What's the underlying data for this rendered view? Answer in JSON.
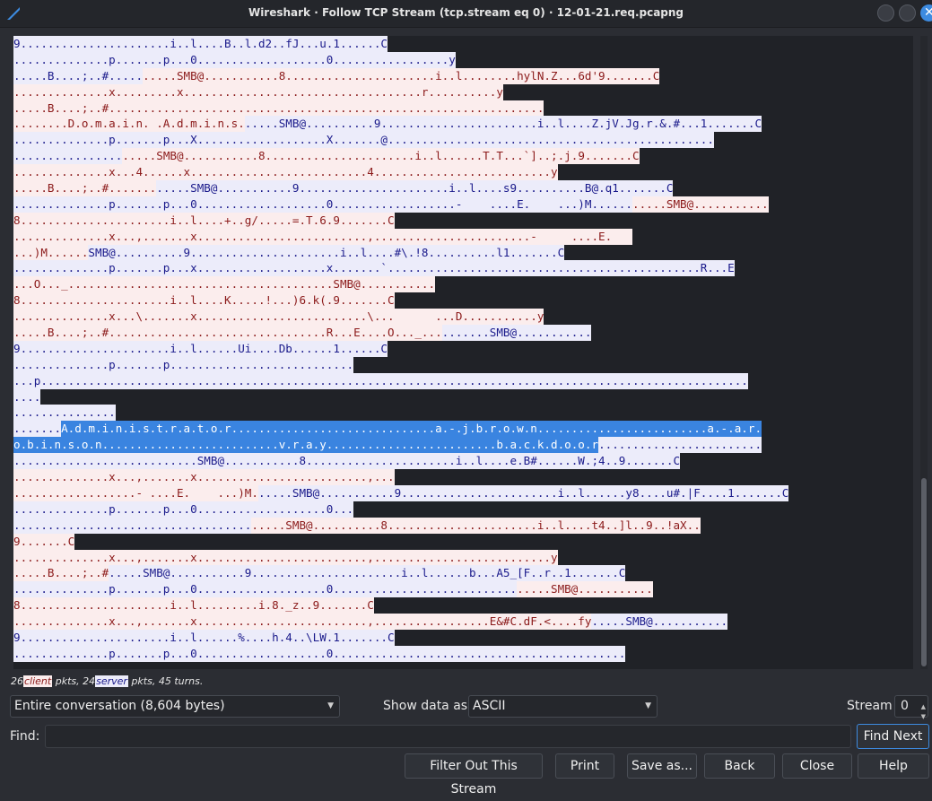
{
  "window": {
    "title": "Wireshark · Follow TCP Stream (tcp.stream eq 0) · 12-01-21.req.pcapng"
  },
  "stream_lines": [
    [
      [
        "s",
        "9......................i..l....B..l.d2..fJ...u.1......C"
      ]
    ],
    [
      [
        "s",
        "..............p.......p...0...................0.................y"
      ]
    ],
    [
      [
        "s",
        ".....B....;..#....."
      ],
      [
        "c",
        ".....SMB@...........8......................i..l........hylN.Z...6d'9.......C"
      ]
    ],
    [
      [
        "c",
        "..............x.........x...................................r..........y"
      ]
    ],
    [
      [
        "c",
        ".....B....;..#................................................................"
      ]
    ],
    [
      [
        "c",
        "........D.o.m.a.i.n. .A.d.m.i.n.s."
      ],
      [
        "s",
        ".....SMB@..........9.......................i..l....Z.jV.Jg.r.&.#...1.......C"
      ]
    ],
    [
      [
        "s",
        "..............p.......p...X...................X.......@................................................"
      ]
    ],
    [
      [
        "s",
        "................"
      ],
      [
        "c",
        ".....SMB@...........8......................i..l......T.T...`]..;.j.9.......C"
      ]
    ],
    [
      [
        "c",
        "..............x...4......x..........................4..........................y"
      ]
    ],
    [
      [
        "c",
        ".....B....;..#......."
      ],
      [
        "s",
        ".....SMB@...........9......................i..l....s9..........B@.q1.......C"
      ]
    ],
    [
      [
        "s",
        "..............p.......p...0...................0..................-    ....E.    ...)M......"
      ],
      [
        "c",
        ".....SMB@..........."
      ]
    ],
    [
      [
        "c",
        "8......................i..l....+..g/.....=.T.6.9.......C"
      ]
    ],
    [
      [
        "c",
        "..............x...,.......x.........................,.......................-     ....E.   "
      ]
    ],
    [
      [
        "c",
        "...)M......"
      ],
      [
        "s",
        "SMB@..........9......................i..l....#\\.!8..........l1.......C"
      ]
    ],
    [
      [
        "s",
        "..............p.......p...x...................x.......`..............................................R...E"
      ]
    ],
    [
      [
        "c",
        "...O..._.......................................SMB@..........."
      ]
    ],
    [
      [
        "c",
        "8......................i..l....K.....!...)6.k(.9.......C"
      ]
    ],
    [
      [
        "c",
        "..............x...\\.......x.........................\\...      ...D...........y"
      ]
    ],
    [
      [
        "c",
        ".....B....;..#................................R...E....O..._..."
      ],
      [
        "s",
        ".......SMB@..........."
      ]
    ],
    [
      [
        "s",
        "9......................i..l......Ui....Db......1......C"
      ]
    ],
    [
      [
        "s",
        "..............p.......p..........................."
      ]
    ],
    [
      [
        "s",
        "...p........................................................................................................"
      ]
    ],
    [
      [
        "s",
        "...."
      ]
    ],
    [
      [
        "s",
        "..............."
      ]
    ],
    [
      [
        "s",
        "......."
      ],
      [
        "h",
        "A.d.m.i.n.i.s.t.r.a.t.o.r..............................a.-.j.b.r.o.w.n.........................a.-.a.r."
      ]
    ],
    [
      [
        "h",
        "o.b.i.n.s.o.n..........................v.r.a.y.........................b.a.c.k.d.o.o.r"
      ],
      [
        "s",
        "........................"
      ]
    ],
    [
      [
        "s",
        "...........................SMB@...........8......................i..l....e.B#......W.;4..9.......C"
      ]
    ],
    [
      [
        "c",
        "..............x...,.......x.........................,..."
      ]
    ],
    [
      [
        "c",
        "..................- ....E.    ...)M."
      ],
      [
        "s",
        ".....SMB@...........9.......................i..l......y8....u#.|F....1.......C"
      ]
    ],
    [
      [
        "s",
        "..............p.......p...0...................0..."
      ]
    ],
    [
      [
        "s",
        "..................................."
      ],
      [
        "c",
        ".....SMB@..........8......................i..l....t4..]l..9..!aX.."
      ]
    ],
    [
      [
        "c",
        "9.......C"
      ]
    ],
    [
      [
        "c",
        "..............x...,.......x.........................,..........................y"
      ]
    ],
    [
      [
        "c",
        ".....B....;..#"
      ],
      [
        "s",
        ".....SMB@...........9......................i..l......b...A5_[F..r..1.......C"
      ]
    ],
    [
      [
        "s",
        "..............p.......p...0...................0..........................."
      ],
      [
        "c",
        ".....SMB@..........."
      ]
    ],
    [
      [
        "c",
        "8......................i..l.........i.8._z..9.......C"
      ]
    ],
    [
      [
        "c",
        "..............x...,.......x.........................,.................E&#C.dF.<....fy"
      ],
      [
        "s",
        ".....SMB@..........."
      ]
    ],
    [
      [
        "s",
        "9......................i..l......%....h.4..\\LW.1.......C"
      ]
    ],
    [
      [
        "s",
        "..............p.......p...0...................0..........................................."
      ]
    ]
  ],
  "stats": {
    "count1": "26",
    "client_word": "client",
    "mid1": "pkts, 24",
    "server_word": "server",
    "mid2": "pkts, 45 turns."
  },
  "controls": {
    "conversation": "Entire conversation (8,604 bytes)",
    "show_data_label": "Show data as",
    "data_format": "ASCII",
    "stream_label": "Stream",
    "stream_value": "0",
    "find_label": "Find:",
    "find_value": ""
  },
  "buttons": {
    "find_next": "Find Next",
    "filter_out": "Filter Out This Stream",
    "print": "Print",
    "save_as": "Save as...",
    "back": "Back",
    "close": "Close",
    "help": "Help"
  },
  "colors": {
    "client_bg": "#fbeded",
    "client_fg": "#8b1a1a",
    "server_bg": "#ececfa",
    "server_fg": "#1a1a8b",
    "highlight": "#3a84e0"
  }
}
